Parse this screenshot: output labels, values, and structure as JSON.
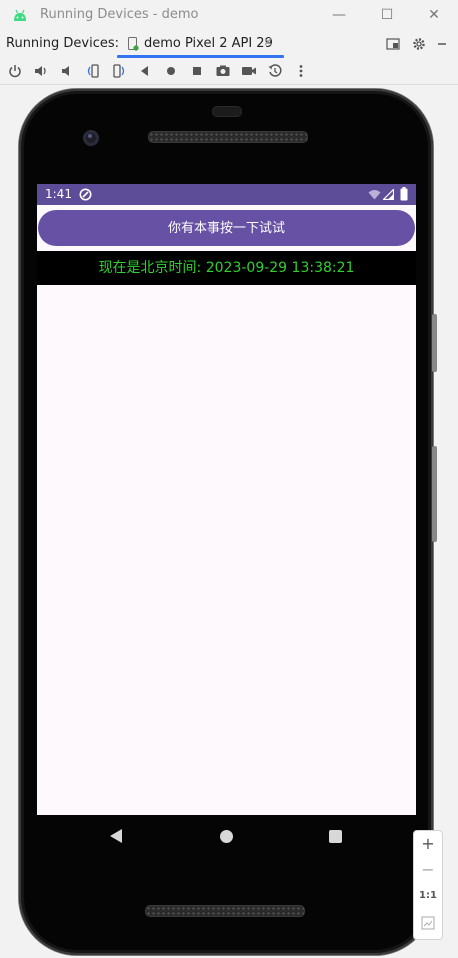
{
  "window": {
    "title": "Running Devices - demo",
    "minimize_label": "—",
    "maximize_label": "☐",
    "close_label": "✕"
  },
  "tool_window": {
    "label": "Running Devices:",
    "tab": {
      "label": "demo Pixel 2 API 29",
      "close": "✕"
    }
  },
  "toolbar": {
    "icons": [
      "power-icon",
      "volume-up-icon",
      "volume-down-icon",
      "rotate-left-icon",
      "rotate-right-icon",
      "back-icon",
      "home-icon",
      "overview-icon",
      "screenshot-icon",
      "screen-record-icon",
      "reset-icon",
      "more-icon"
    ]
  },
  "device": {
    "status_bar": {
      "time": "1:41",
      "color": "#5d4c98"
    },
    "button_label": "你有本事按一下试试",
    "button_color": "#6751a5",
    "time_text": "现在是北京时间: 2023-09-29 13:38:21",
    "time_text_color": "#2ed12e"
  },
  "zoom": {
    "zoom_in": "+",
    "zoom_out": "−",
    "one_to_one": "1:1"
  }
}
